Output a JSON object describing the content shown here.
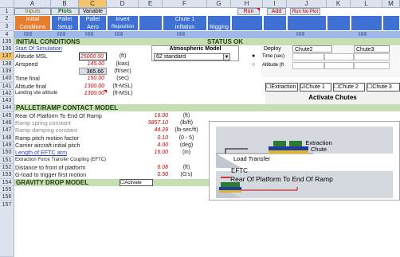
{
  "columns": [
    "A",
    "B",
    "C",
    "D",
    "E",
    "F",
    "G",
    "H",
    "I",
    "J",
    "K",
    "L",
    "M"
  ],
  "selected_column": "C",
  "rows": [
    "1",
    "2",
    "3",
    "4",
    "135",
    "136",
    "137",
    "138",
    "139",
    "140",
    "141",
    "142",
    "143",
    "144",
    "145",
    "146",
    "147",
    "148",
    "149",
    "150",
    "151",
    "152",
    "153",
    "154",
    "155",
    "156",
    "157"
  ],
  "selected_row": "137",
  "tabs": {
    "inputs": "Inputs",
    "plots": "Plots",
    "variable": "Variable"
  },
  "toolbar": {
    "run": "Run",
    "add": "Add",
    "run_no_plot": "Run No Plot"
  },
  "row2": {
    "initial": "Initial",
    "pallet": "Pallet",
    "pallet2": "Pallet",
    "invert": "Invert",
    "chute1": "Chute 1"
  },
  "row3": {
    "conditions": "Conditions",
    "setup": "Setup",
    "aero": "Aero",
    "reposition": "Reposition",
    "inflation": "Inflation",
    "rigging": "Rigging"
  },
  "row4_marks": [
    "||||||||",
    "||||||||",
    "||||||||",
    "||||||||",
    "||||||||",
    "||||||||",
    "||||||||"
  ],
  "section_initial": "INITIAL CONDITIONS",
  "status": "STATUS OK",
  "start_sim": "Start Of Simulation",
  "atmo_label": "Atmospheric Model",
  "atmo_value": "62 standard",
  "deploy_label": "Deploy",
  "chute2": "Chute2",
  "chute3": "Chute3",
  "radio_time": "Time (sec)",
  "radio_alt": "Altitude (ft",
  "params1": [
    {
      "label": "Altitude MSL",
      "value": "25000.00",
      "unit": "(ft)"
    },
    {
      "label": "Airspeed",
      "value": "145.00",
      "unit": "(kias)"
    },
    {
      "label": "",
      "value": "365.66",
      "unit": "(ft/sec)"
    },
    {
      "label": "Time final",
      "value": "150.00",
      "unit": "(sec)"
    },
    {
      "label": "Altitude final",
      "value": "1300.00",
      "unit": "(ft-MSL)"
    },
    {
      "label": "Landing site altitude",
      "value": "1300.00",
      "unit": "(ft-MSL)"
    }
  ],
  "checkboxes": {
    "extraction": "Extraction",
    "chute1": "Chute 1",
    "chute2": "Chute 2",
    "chute3": "Chute 3"
  },
  "activate_chutes": "Activate Chutes",
  "section_pallet": "PALLET/RAMP CONTACT MODEL",
  "params2": [
    {
      "label": "Rear Of Platform To End Of Ramp",
      "value": "16.00",
      "unit": "(ft)",
      "dim": false
    },
    {
      "label": "Ramp spring constant",
      "value": "5857.10",
      "unit": "(lb/ft)",
      "dim": true
    },
    {
      "label": "Ramp damping constant",
      "value": "44.29",
      "unit": "(lb-sec/ft)",
      "dim": true
    },
    {
      "label": "Ramp pitch motion factor",
      "value": "0.10",
      "unit": "(0 - 5)",
      "dim": false
    },
    {
      "label": "Carrier aircraft initial pitch",
      "value": "4.00",
      "unit": "(deg)",
      "dim": false
    },
    {
      "label": "Length of EFTC arm",
      "value": "16.00",
      "unit": "(in)",
      "dim": false
    },
    {
      "label": "Extraction Force Transfer Coupling (EFTC)",
      "value": "",
      "unit": "",
      "dim": false
    },
    {
      "label": "Distance to front of platform",
      "value": "6.08",
      "unit": "(ft)",
      "dim": false
    },
    {
      "label": "G-load to trigger first motion",
      "value": "0.50",
      "unit": "(G's)",
      "dim": false
    }
  ],
  "section_gravity": "GRAVITY DROP MODEL",
  "gravity_activate": "Activate",
  "diagram": {
    "extraction_chute": "Extraction\nChute",
    "load_transfer": "Load Transfer",
    "eftc": "EFTC",
    "rear_platform": "Rear Of Platform To End Of Ramp"
  }
}
